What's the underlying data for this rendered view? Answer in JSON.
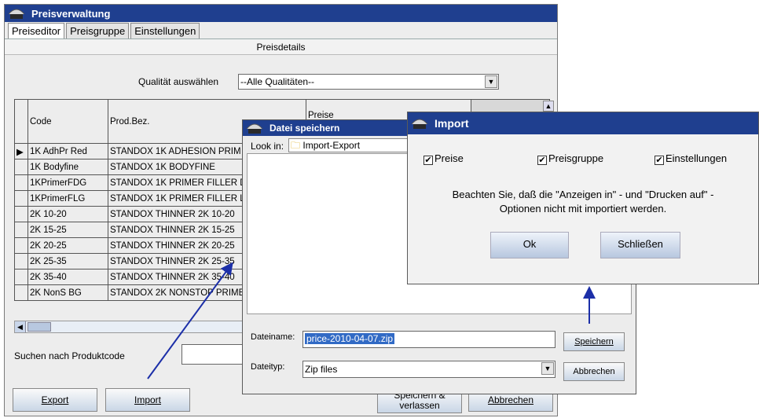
{
  "main": {
    "title": "Preisverwaltung",
    "tabs": [
      "Preiseditor",
      "Preisgruppe",
      "Einstellungen"
    ],
    "section_title": "Preisdetails",
    "quality_label": "Qualität auswählen",
    "quality_value": "--Alle Qualitäten--",
    "columns": [
      "Code",
      "Prod.Bez.",
      "Preise"
    ],
    "rows": [
      {
        "code": "1K AdhPr Red",
        "desc": "STANDOX 1K ADHESION PRIM"
      },
      {
        "code": "1K Bodyfine",
        "desc": "STANDOX 1K BODYFINE"
      },
      {
        "code": "1KPrimerFDG",
        "desc": "STANDOX 1K PRIMER FILLER D"
      },
      {
        "code": "1KPrimerFLG",
        "desc": "STANDOX 1K PRIMER FILLER L"
      },
      {
        "code": "2K 10-20",
        "desc": "STANDOX THINNER 2K 10-20"
      },
      {
        "code": "2K 15-25",
        "desc": "STANDOX THINNER 2K 15-25"
      },
      {
        "code": "2K 20-25",
        "desc": "STANDOX THINNER 2K 20-25"
      },
      {
        "code": "2K 25-35",
        "desc": "STANDOX THINNER 2K 25-35"
      },
      {
        "code": "2K 35-40",
        "desc": "STANDOX THINNER 2K 35-40"
      },
      {
        "code": "2K NonS BG",
        "desc": "STANDOX 2K NONSTOP PRIME"
      }
    ],
    "search_label": "Suchen nach Produktcode",
    "export_button": "Export",
    "import_button": "Import",
    "save_leave_button_line1": "Speichern &",
    "save_leave_button_line2": "verlassen",
    "cancel_button": "Abbrechen"
  },
  "save_dialog": {
    "title": "Datei speichern",
    "lookin_label": "Look in:",
    "lookin_value": "Import-Export",
    "filename_label": "Dateiname:",
    "filename_value": "price-2010-04-07.zip",
    "filetype_label": "Dateityp:",
    "filetype_value": "Zip files",
    "save_button": "Speichern",
    "cancel_button": "Abbrechen"
  },
  "import_dialog": {
    "title": "Import",
    "checkboxes": [
      "Preise",
      "Preisgruppe",
      "Einstellungen"
    ],
    "message_line1": "Beachten Sie, daß die \"Anzeigen in\" - und \"Drucken auf\" -",
    "message_line2": "Optionen nicht mit importiert werden.",
    "ok_button": "Ok",
    "close_button": "Schließen"
  },
  "colors": {
    "titlebar": "#1f3f8f",
    "arrow": "#1c2fa8"
  },
  "icons": [
    "app-icon",
    "folder-icon",
    "dropdown-arrow-icon",
    "scroll-up-icon",
    "scroll-left-icon",
    "row-pointer-icon",
    "checkbox-checked-icon"
  ]
}
